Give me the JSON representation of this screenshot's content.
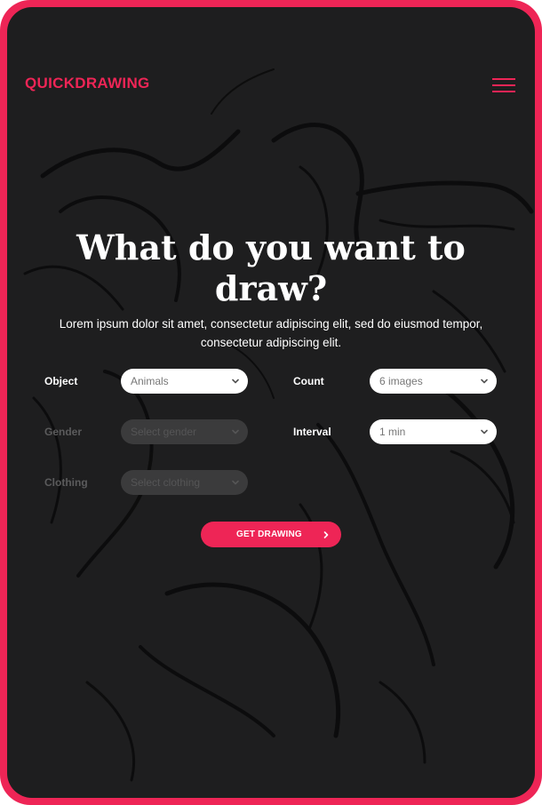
{
  "header": {
    "logo": "QUICKDRAWING",
    "menu_icon": "hamburger-menu-icon"
  },
  "hero": {
    "title": "What do you want to draw?",
    "subtitle": "Lorem ipsum dolor sit amet, consectetur adipiscing elit, sed do eiusmod tempor, consectetur adipiscing elit."
  },
  "form": {
    "object": {
      "label": "Object",
      "value": "Animals",
      "enabled": true
    },
    "count": {
      "label": "Count",
      "value": "6 images",
      "enabled": true
    },
    "gender": {
      "label": "Gender",
      "placeholder": "Select gender",
      "enabled": false
    },
    "interval": {
      "label": "Interval",
      "value": "1 min",
      "enabled": true
    },
    "clothing": {
      "label": "Clothing",
      "placeholder": "Select clothing",
      "enabled": false
    },
    "submit_label": "GET DRAWING"
  },
  "colors": {
    "accent": "#ee2556",
    "background": "#1e1e1f",
    "disabled_field": "#3b3b3c"
  }
}
